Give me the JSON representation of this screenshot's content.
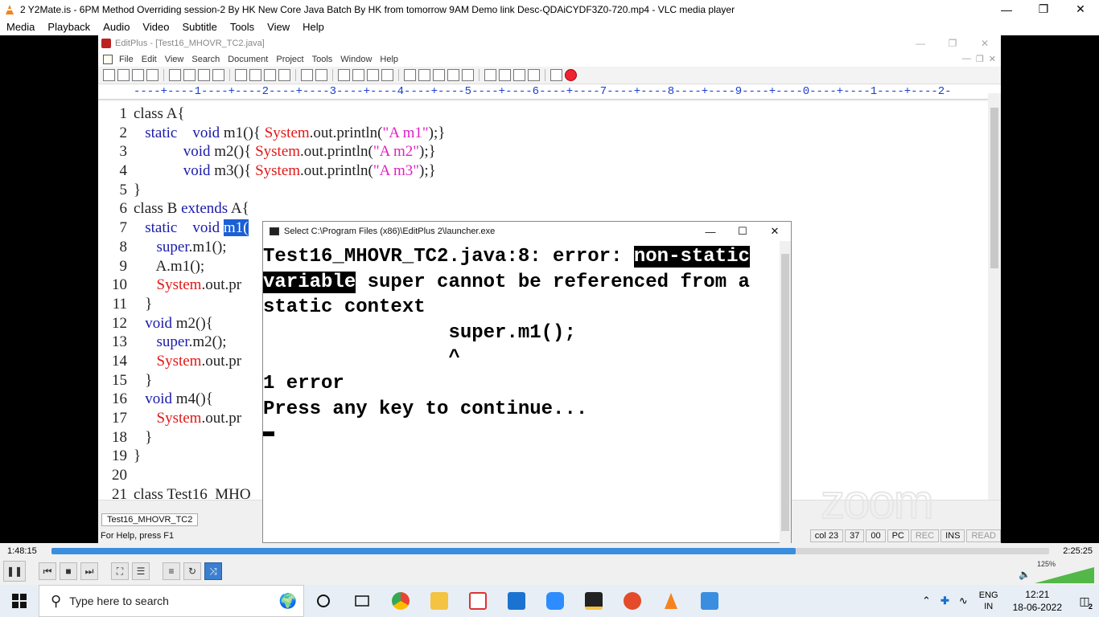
{
  "vlc": {
    "title": "2 Y2Mate.is - 6PM Method Overriding session-2 By HK New Core Java Batch By HK from tomorrow 9AM  Demo link Desc-QDAiCYDF3Z0-720.mp4 - VLC media player",
    "menu": [
      "Media",
      "Playback",
      "Audio",
      "Video",
      "Subtitle",
      "Tools",
      "View",
      "Help"
    ],
    "time_elapsed": "1:48:15",
    "time_total": "2:25:25",
    "progress": 0.746,
    "volume_label": "125%"
  },
  "editplus": {
    "title": "EditPlus - [Test16_MHOVR_TC2.java]",
    "menu": [
      "File",
      "Edit",
      "View",
      "Search",
      "Document",
      "Project",
      "Tools",
      "Window",
      "Help"
    ],
    "ruler": "----+----1----+----2----+----3----+----4----+----5----+----6----+----7----+----8----+----9----+----0----+----1----+----2-",
    "line_numbers": [
      "1",
      "2",
      "3",
      "4",
      "5",
      "6",
      "7",
      "8",
      "9",
      "10",
      "11",
      "12",
      "13",
      "14",
      "15",
      "16",
      "17",
      "18",
      "19",
      "20",
      "21"
    ],
    "tab_label": "Test16_MHOVR_TC2",
    "status_help": "For Help, press F1",
    "status_cells": [
      "col 23",
      "37",
      "00",
      "PC",
      "REC",
      "INS",
      "READ"
    ]
  },
  "console": {
    "title": "Select C:\\Program Files (x86)\\EditPlus 2\\launcher.exe",
    "line1_a": "Test16_MHOVR_TC2.java:8: error: ",
    "line1_hl": "non-static",
    "line2_hl": "variable",
    "line2_b": " super cannot be referenced from a",
    "line3": "static context",
    "line4": "                super.m1();",
    "line5": "                ^",
    "line6": "1 error",
    "line7": "",
    "line8": "Press any key to continue..."
  },
  "watermark": "zoom",
  "taskbar": {
    "search_placeholder": "Type here to search",
    "lang_top": "ENG",
    "lang_bottom": "IN",
    "time": "12:21",
    "date": "18-06-2022",
    "notif_count": "2"
  }
}
